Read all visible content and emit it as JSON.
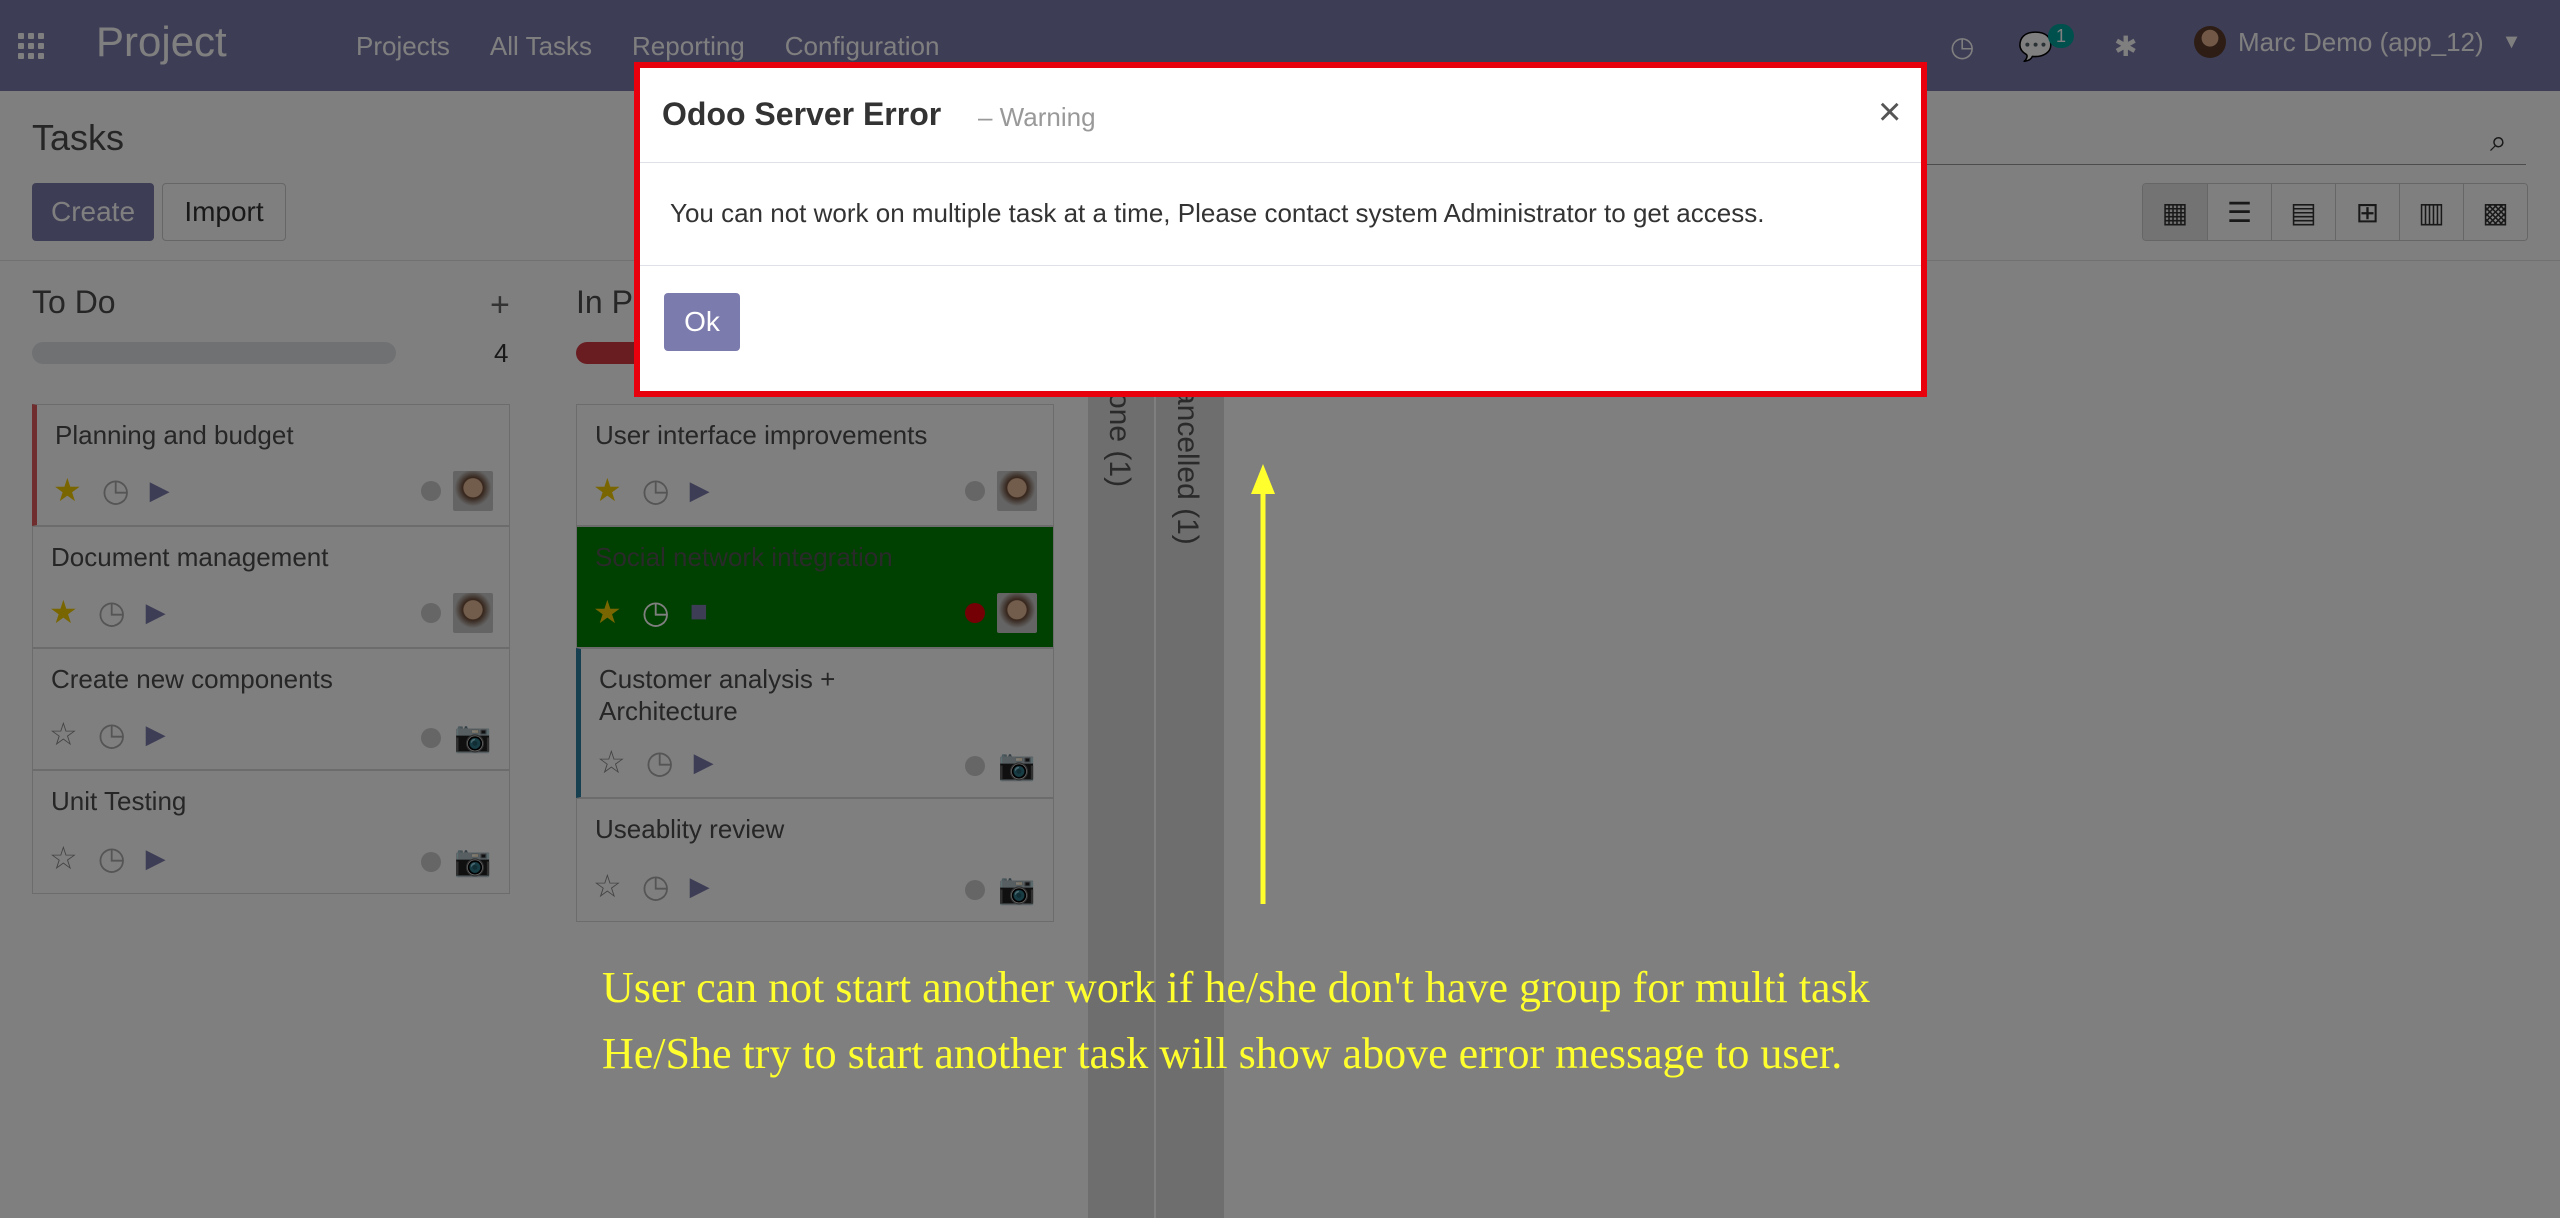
{
  "navbar": {
    "brand": "Project",
    "menu": [
      "Projects",
      "All Tasks",
      "Reporting",
      "Configuration"
    ],
    "message_count": "1",
    "user": "Marc Demo (app_12)",
    "icons": [
      "apps-icon",
      "clock-icon",
      "chat-icon",
      "bug-icon",
      "chevron-down-icon"
    ]
  },
  "control_panel": {
    "title": "Tasks",
    "create_label": "Create",
    "import_label": "Import",
    "views": [
      "kanban-view-icon",
      "list-view-icon",
      "calendar-view-icon",
      "pivot-view-icon",
      "graph-view-icon",
      "grid-view-icon"
    ]
  },
  "columns": [
    {
      "name": "To Do",
      "count": "4",
      "cards": [
        {
          "title": "Planning and budget",
          "starred": true,
          "state": "play",
          "avatar": "photo"
        },
        {
          "title": "Document management",
          "starred": true,
          "state": "play",
          "avatar": "photo"
        },
        {
          "title": "Create new components",
          "starred": false,
          "state": "play",
          "avatar": "camera"
        },
        {
          "title": "Unit Testing",
          "starred": false,
          "state": "play",
          "avatar": "camera"
        }
      ]
    },
    {
      "name": "In P",
      "cards": [
        {
          "title": "User interface improvements",
          "starred": true,
          "state": "play",
          "avatar": "photo"
        },
        {
          "title": "Social network integration",
          "starred": true,
          "state": "stop",
          "avatar": "photo",
          "color": "#008000",
          "blocked": true
        },
        {
          "title": "Customer analysis + Architecture",
          "starred": false,
          "state": "play",
          "avatar": "camera"
        },
        {
          "title": "Useablity review",
          "starred": false,
          "state": "play",
          "avatar": "camera"
        }
      ]
    }
  ],
  "folded_columns": [
    "one (1)",
    "ancelled (1)"
  ],
  "dialog": {
    "title": "Odoo Server Error",
    "subtitle": "– Warning",
    "message": "You can not work on multiple task at a time, Please contact system Administrator to get access.",
    "ok_label": "Ok"
  },
  "annotation": {
    "line1": "User can not start another work if he/she don't have group for multi task",
    "line2": "He/She try to start another task will show above error message to user.",
    "color": "#ffff2e",
    "border_color": "#e8000c"
  }
}
